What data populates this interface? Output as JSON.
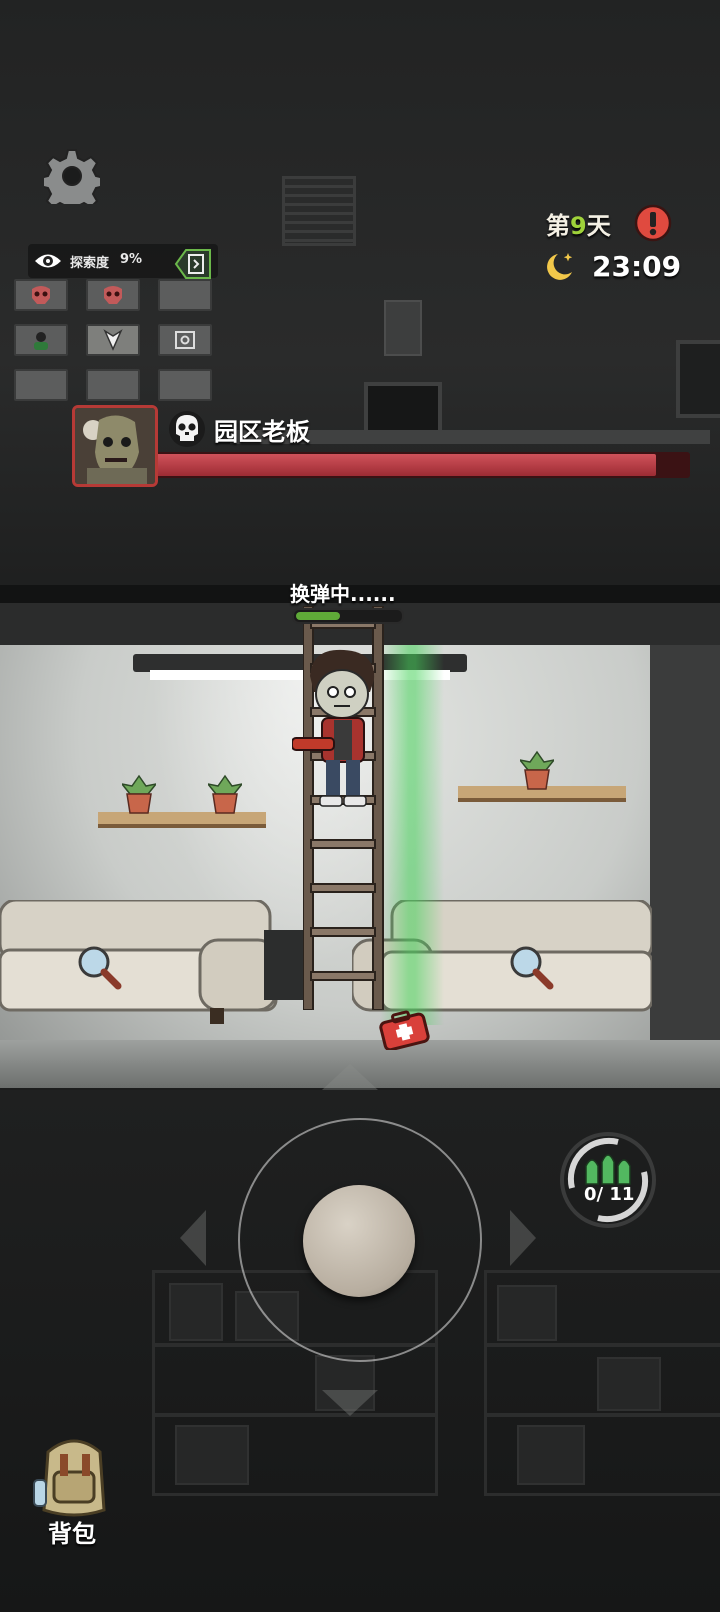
{
  "hud": {
    "explore_label": "探索度",
    "explore_percent": "9%",
    "day_prefix": "第",
    "day_number": "9",
    "day_suffix": "天",
    "time": "23:09"
  },
  "boss": {
    "name": "园区老板",
    "hp_fraction": 0.94
  },
  "reload": {
    "text": "换弹中......",
    "progress_fraction": 0.42
  },
  "ammo": {
    "count": "0/ 11"
  },
  "backpack": {
    "label": "背包"
  },
  "minimap": {
    "rows": [
      [
        "zombie-icon",
        "",
        "zombie-icon",
        "",
        ""
      ],
      [
        "npc-icon",
        "",
        "player-icon",
        "",
        "safe-icon"
      ],
      [
        "",
        "",
        "",
        "",
        ""
      ]
    ]
  },
  "colors": {
    "boss_hp": "#c1444c",
    "reload_fill": "#5faa38",
    "day_number": "#9fd23a",
    "alert": "#e04a3f",
    "beam": "#46d25a"
  }
}
